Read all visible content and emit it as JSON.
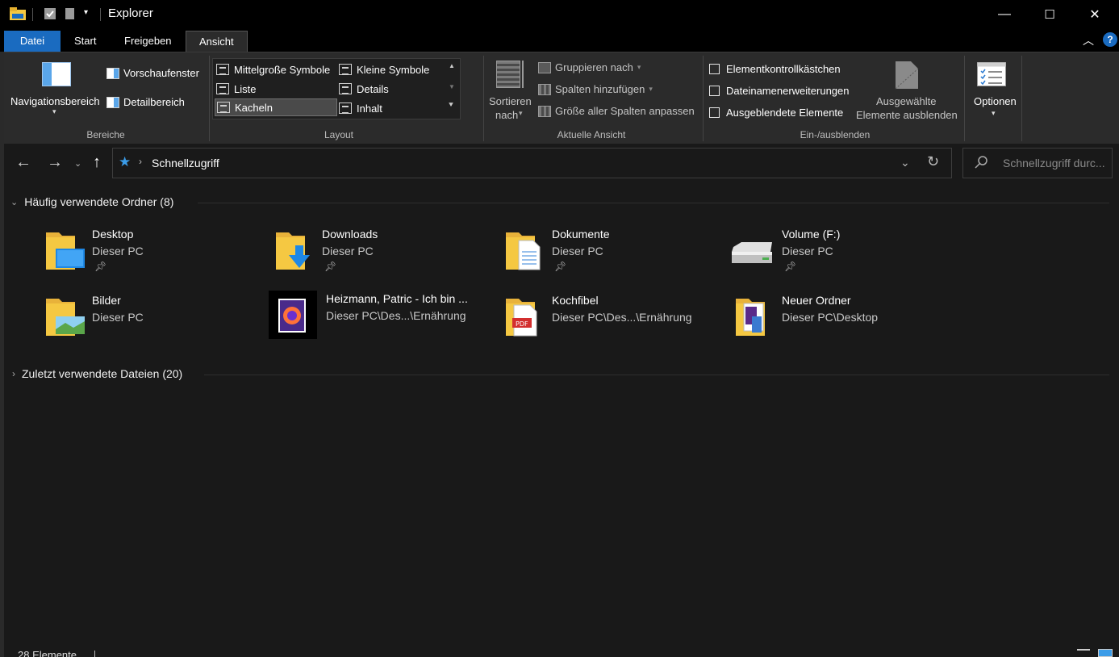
{
  "window": {
    "title": "Explorer",
    "min_glyph": "—",
    "max_glyph": "☐",
    "close_glyph": "✕"
  },
  "tabs": [
    {
      "label": "Datei"
    },
    {
      "label": "Start"
    },
    {
      "label": "Freigeben"
    },
    {
      "label": "Ansicht"
    }
  ],
  "ribbon": {
    "bereiche": {
      "navigationsbereich": "Navigationsbereich",
      "vorschaufenster": "Vorschaufenster",
      "detailbereich": "Detailbereich",
      "group_label": "Bereiche"
    },
    "layout": {
      "items": [
        "Mittelgroße Symbole",
        "Kleine Symbole",
        "Liste",
        "Details",
        "Kacheln",
        "Inhalt"
      ],
      "selected": "Kacheln",
      "group_label": "Layout"
    },
    "aktuelle_ansicht": {
      "sortieren": "Sortieren",
      "nach": "nach",
      "gruppieren": "Gruppieren nach",
      "spalten_hinzu": "Spalten hinzufügen",
      "groesse": "Größe aller Spalten anpassen",
      "group_label": "Aktuelle Ansicht"
    },
    "ein_ausblenden": {
      "elementkontroll": "Elementkontrollkästchen",
      "dateinamen": "Dateinamenerweiterungen",
      "ausgeblendete": "Ausgeblendete Elemente",
      "ausgewaehlte_1": "Ausgewählte",
      "ausgewaehlte_2": "Elemente ausblenden",
      "group_label": "Ein-/ausblenden"
    },
    "optionen": "Optionen"
  },
  "address": {
    "path": "Schnellzugriff",
    "search_placeholder": "Schnellzugriff durc..."
  },
  "sections": {
    "frequent": "Häufig verwendete Ordner (8)",
    "recent": "Zuletzt verwendete Dateien (20)"
  },
  "tiles": [
    {
      "name": "Desktop",
      "location": "Dieser PC",
      "pinned": true
    },
    {
      "name": "Downloads",
      "location": "Dieser PC",
      "pinned": true
    },
    {
      "name": "Dokumente",
      "location": "Dieser PC",
      "pinned": true
    },
    {
      "name": "Volume (F:)",
      "location": "Dieser PC",
      "pinned": true
    },
    {
      "name": "Bilder",
      "location": "Dieser PC",
      "pinned": false
    },
    {
      "name": "Heizmann, Patric - Ich bin ...",
      "location": "Dieser PC\\Des...\\Ernährung",
      "pinned": false
    },
    {
      "name": "Kochfibel",
      "location": "Dieser PC\\Des...\\Ernährung",
      "pinned": false
    },
    {
      "name": "Neuer Ordner",
      "location": "Dieser PC\\Desktop",
      "pinned": false
    }
  ],
  "status": {
    "count": "28 Elemente"
  },
  "colors": {
    "accent": "#1a6bc0",
    "folder": "#f5c842",
    "background": "#191919"
  }
}
